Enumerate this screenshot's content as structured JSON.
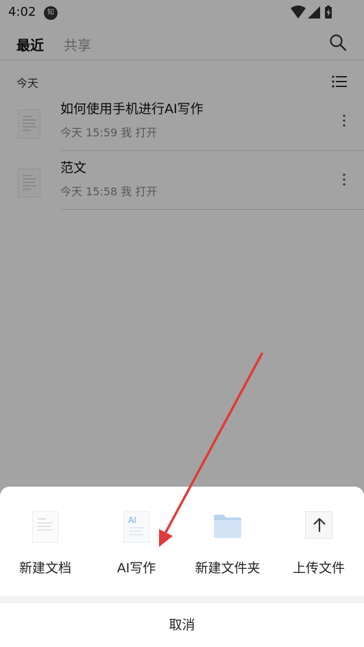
{
  "status_bar": {
    "time": "4:02",
    "notification_badge": "知",
    "icons": [
      "wifi-icon",
      "signal-icon",
      "battery-charging-icon"
    ]
  },
  "tabs": [
    {
      "label": "最近",
      "active": true
    },
    {
      "label": "共享",
      "active": false
    }
  ],
  "section": {
    "title": "今天"
  },
  "files": [
    {
      "name": "如何使用手机进行AI写作",
      "meta": "今天 15:59 我 打开"
    },
    {
      "name": "范文",
      "meta": "今天 15:58 我 打开"
    }
  ],
  "sheet": {
    "actions": [
      {
        "label": "新建文档",
        "icon": "new-document-icon"
      },
      {
        "label": "AI写作",
        "icon": "ai-writing-icon",
        "icon_text": "AI"
      },
      {
        "label": "新建文件夹",
        "icon": "new-folder-icon"
      },
      {
        "label": "上传文件",
        "icon": "upload-icon"
      }
    ],
    "cancel_label": "取消"
  },
  "colors": {
    "scrim": "rgba(0,0,0,0.36)",
    "annotation_arrow": "#e03a3a",
    "folder": "#bcd3ef"
  }
}
